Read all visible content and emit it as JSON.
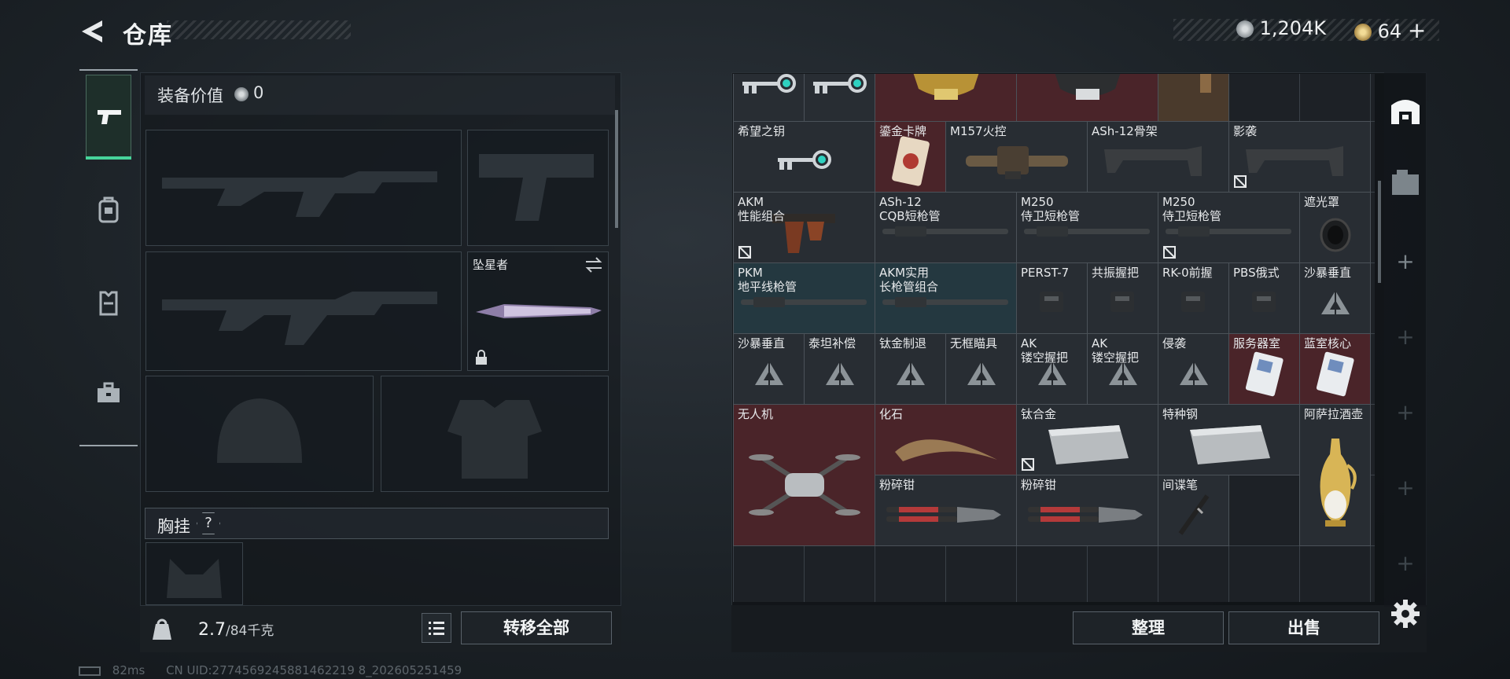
{
  "header": {
    "title": "仓库",
    "back_icon": "back-arrow-icon"
  },
  "currency": {
    "silver": "1,204K",
    "gold": "64",
    "gold_add": "+"
  },
  "left_tabs": [
    "weapon-tab",
    "backpack-tab",
    "vest-tab",
    "toolbox-tab"
  ],
  "equipment": {
    "value_label": "装备价值",
    "value": "0",
    "melee_name": "坠星者",
    "rig_label": "胸挂",
    "rig_help": "?",
    "weight": "2.7",
    "weight_capacity": "/84千克",
    "transfer_all": "转移全部"
  },
  "storage": {
    "cells": [
      {
        "id": "c0",
        "name": "",
        "col": 0,
        "row": -1,
        "w": 1,
        "h": 1,
        "bg": "gray",
        "img": "key"
      },
      {
        "id": "c1",
        "name": "",
        "col": 1,
        "row": -1,
        "w": 1,
        "h": 1,
        "bg": "gray",
        "img": "key"
      },
      {
        "id": "c2",
        "name": "",
        "col": 2,
        "row": -1,
        "w": 2,
        "h": 1,
        "bg": "red",
        "img": "gold-bust"
      },
      {
        "id": "c3",
        "name": "",
        "col": 4,
        "row": -1,
        "w": 2,
        "h": 1,
        "bg": "red",
        "img": "bust"
      },
      {
        "id": "c4",
        "name": "",
        "col": 6,
        "row": -1,
        "w": 1,
        "h": 1,
        "bg": "brown",
        "img": "box"
      },
      {
        "id": "c5",
        "name": "希望之钥",
        "col": 0,
        "row": 0,
        "w": 2,
        "h": 1,
        "bg": "gray",
        "img": "key"
      },
      {
        "id": "c6",
        "name": "鎏金卡牌",
        "col": 2,
        "row": 0,
        "w": 1,
        "h": 1,
        "bg": "red",
        "img": "card"
      },
      {
        "id": "c7",
        "name": "M157火控",
        "col": 3,
        "row": 0,
        "w": 2,
        "h": 1,
        "bg": "gray",
        "img": "scope"
      },
      {
        "id": "c8",
        "name": "ASh-12骨架",
        "col": 5,
        "row": 0,
        "w": 2,
        "h": 1,
        "bg": "gray",
        "img": "stock"
      },
      {
        "id": "c9",
        "name": "影袭",
        "col": 7,
        "row": 0,
        "w": 2,
        "h": 1,
        "bg": "gray",
        "img": "stock",
        "cross": true
      },
      {
        "id": "c10",
        "name": "AKM\n性能组合",
        "col": 0,
        "row": 1,
        "w": 2,
        "h": 1,
        "bg": "gray",
        "img": "grip",
        "cross": true
      },
      {
        "id": "c11",
        "name": "ASh-12\nCQB短枪管",
        "col": 2,
        "row": 1,
        "w": 2,
        "h": 1,
        "bg": "gray",
        "img": "barrel"
      },
      {
        "id": "c12",
        "name": "M250\n侍卫短枪管",
        "col": 4,
        "row": 1,
        "w": 2,
        "h": 1,
        "bg": "gray",
        "img": "barrel"
      },
      {
        "id": "c13",
        "name": "M250\n侍卫短枪管",
        "col": 6,
        "row": 1,
        "w": 2,
        "h": 1,
        "bg": "gray",
        "img": "barrel",
        "cross": true
      },
      {
        "id": "c14",
        "name": "遮光罩",
        "col": 8,
        "row": 1,
        "w": 1,
        "h": 1,
        "bg": "gray",
        "img": "hood"
      },
      {
        "id": "c15",
        "name": "PKM\n地平线枪管",
        "col": 0,
        "row": 2,
        "w": 2,
        "h": 1,
        "bg": "teal",
        "img": "barrel"
      },
      {
        "id": "c16",
        "name": "AKM实用\n长枪管组合",
        "col": 2,
        "row": 2,
        "w": 2,
        "h": 1,
        "bg": "teal",
        "img": "barrel"
      },
      {
        "id": "c17",
        "name": "PERST-7",
        "col": 4,
        "row": 2,
        "w": 1,
        "h": 1,
        "bg": "gray",
        "img": "small"
      },
      {
        "id": "c18",
        "name": "共振握把",
        "col": 5,
        "row": 2,
        "w": 1,
        "h": 1,
        "bg": "gray",
        "img": "small"
      },
      {
        "id": "c19",
        "name": "RK-0前握",
        "col": 6,
        "row": 2,
        "w": 1,
        "h": 1,
        "bg": "gray",
        "img": "small"
      },
      {
        "id": "c20",
        "name": "PBS俄式",
        "col": 7,
        "row": 2,
        "w": 1,
        "h": 1,
        "bg": "gray",
        "img": "small"
      },
      {
        "id": "c21",
        "name": "沙暴垂直",
        "col": 8,
        "row": 2,
        "w": 1,
        "h": 1,
        "bg": "gray",
        "img": "tri"
      },
      {
        "id": "c22",
        "name": "沙暴垂直",
        "col": 0,
        "row": 3,
        "w": 1,
        "h": 1,
        "bg": "gray",
        "img": "tri"
      },
      {
        "id": "c23",
        "name": "泰坦补偿",
        "col": 1,
        "row": 3,
        "w": 1,
        "h": 1,
        "bg": "gray",
        "img": "tri"
      },
      {
        "id": "c24",
        "name": "钛金制退",
        "col": 2,
        "row": 3,
        "w": 1,
        "h": 1,
        "bg": "gray",
        "img": "tri"
      },
      {
        "id": "c25",
        "name": "无框瞄具",
        "col": 3,
        "row": 3,
        "w": 1,
        "h": 1,
        "bg": "gray",
        "img": "tri"
      },
      {
        "id": "c26",
        "name": "AK\n镂空握把",
        "col": 4,
        "row": 3,
        "w": 1,
        "h": 1,
        "bg": "gray",
        "img": "tri"
      },
      {
        "id": "c27",
        "name": "AK\n镂空握把",
        "col": 5,
        "row": 3,
        "w": 1,
        "h": 1,
        "bg": "gray",
        "img": "tri"
      },
      {
        "id": "c28",
        "name": "侵袭",
        "col": 6,
        "row": 3,
        "w": 1,
        "h": 1,
        "bg": "gray",
        "img": "tri"
      },
      {
        "id": "c29",
        "name": "服务器室",
        "col": 7,
        "row": 3,
        "w": 1,
        "h": 1,
        "bg": "red",
        "img": "keycard"
      },
      {
        "id": "c30",
        "name": "蓝室核心",
        "col": 8,
        "row": 3,
        "w": 1,
        "h": 1,
        "bg": "red",
        "img": "keycard"
      },
      {
        "id": "c31",
        "name": "无人机",
        "col": 0,
        "row": 4,
        "w": 2,
        "h": 2,
        "bg": "red",
        "img": "drone"
      },
      {
        "id": "c32",
        "name": "化石",
        "col": 2,
        "row": 4,
        "w": 2,
        "h": 1,
        "bg": "red",
        "img": "claw"
      },
      {
        "id": "c33",
        "name": "钛合金",
        "col": 4,
        "row": 4,
        "w": 2,
        "h": 1,
        "bg": "gray",
        "img": "ingot",
        "cross": true
      },
      {
        "id": "c34",
        "name": "特种钢",
        "col": 6,
        "row": 4,
        "w": 2,
        "h": 1,
        "bg": "gray",
        "img": "ingot"
      },
      {
        "id": "c35",
        "name": "阿萨拉酒壶",
        "col": 8,
        "row": 4,
        "w": 1,
        "h": 2,
        "bg": "gray",
        "img": "jug"
      },
      {
        "id": "c36",
        "name": "粉碎钳",
        "col": 2,
        "row": 5,
        "w": 2,
        "h": 1,
        "bg": "gray",
        "img": "cutter"
      },
      {
        "id": "c37",
        "name": "粉碎钳",
        "col": 4,
        "row": 5,
        "w": 2,
        "h": 1,
        "bg": "gray",
        "img": "cutter"
      },
      {
        "id": "c38",
        "name": "间谍笔",
        "col": 6,
        "row": 5,
        "w": 1,
        "h": 1,
        "bg": "gray",
        "img": "pen"
      }
    ],
    "sort": "整理",
    "sell": "出售"
  },
  "status": {
    "ping": "82ms",
    "uid": "CN UID:2774569245881462219 8_202605251459"
  },
  "colors": {
    "accent": "#47d49a",
    "red_cell": "#4a2429",
    "teal_cell": "#243840"
  }
}
